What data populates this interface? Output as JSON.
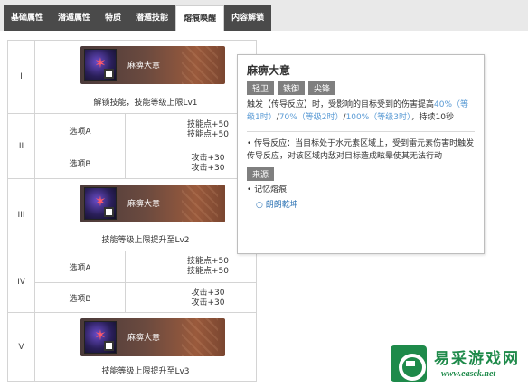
{
  "tabs": [
    {
      "label": "基础属性"
    },
    {
      "label": "潜遁属性"
    },
    {
      "label": "特质"
    },
    {
      "label": "潜遁技能"
    },
    {
      "label": "熔痕唤醒"
    },
    {
      "label": "内容解锁"
    }
  ],
  "table": {
    "rows": [
      {
        "num": "I",
        "skill_name": "麻痹大意",
        "caption": "解锁技能，技能等级上限Lv1"
      },
      {
        "num": "II",
        "options": [
          {
            "label": "选项A",
            "lines": [
              "技能点+50",
              "技能点+50"
            ]
          },
          {
            "label": "选项B",
            "lines": [
              "攻击+30",
              "攻击+30"
            ]
          }
        ]
      },
      {
        "num": "III",
        "skill_name": "麻痹大意",
        "caption": "技能等级上限提升至Lv2"
      },
      {
        "num": "IV",
        "options": [
          {
            "label": "选项A",
            "lines": [
              "技能点+50",
              "技能点+50"
            ]
          },
          {
            "label": "选项B",
            "lines": [
              "攻击+30",
              "攻击+30"
            ]
          }
        ]
      },
      {
        "num": "V",
        "skill_name": "麻痹大意",
        "caption": "技能等级上限提升至Lv3"
      }
    ]
  },
  "tooltip": {
    "title": "麻痹大意",
    "tags": [
      "轻卫",
      "铁御",
      "尖锋"
    ],
    "desc_pre": "触发【传导反应】时，受影响的目标受到的伤害提高",
    "lv1": "40%（等级1时）",
    "lv2": "70%（等级2时）",
    "lv3": "100%（等级3时）",
    "desc_post": "，持续10秒",
    "bullet": "传导反应：当目标处于水元素区域上，受到雷元素伤害时触发传导反应，对该区域内敌对目标造成眩晕使其无法行动",
    "source_tag": "来源",
    "source_type": "记忆熔痕",
    "source_name": "朗朗乾坤"
  },
  "watermark": {
    "title": "易采游戏网",
    "url": "www.easck.net"
  },
  "colors": {
    "tabbar_bg": "#4a4a4a",
    "tag_bg": "#7f7f7f",
    "highlight": "#5b9bd5",
    "link": "#2e74b5",
    "watermark_green": "#1e8a4a"
  },
  "icons": [
    "skill-icon",
    "watermark-logo-icon"
  ]
}
